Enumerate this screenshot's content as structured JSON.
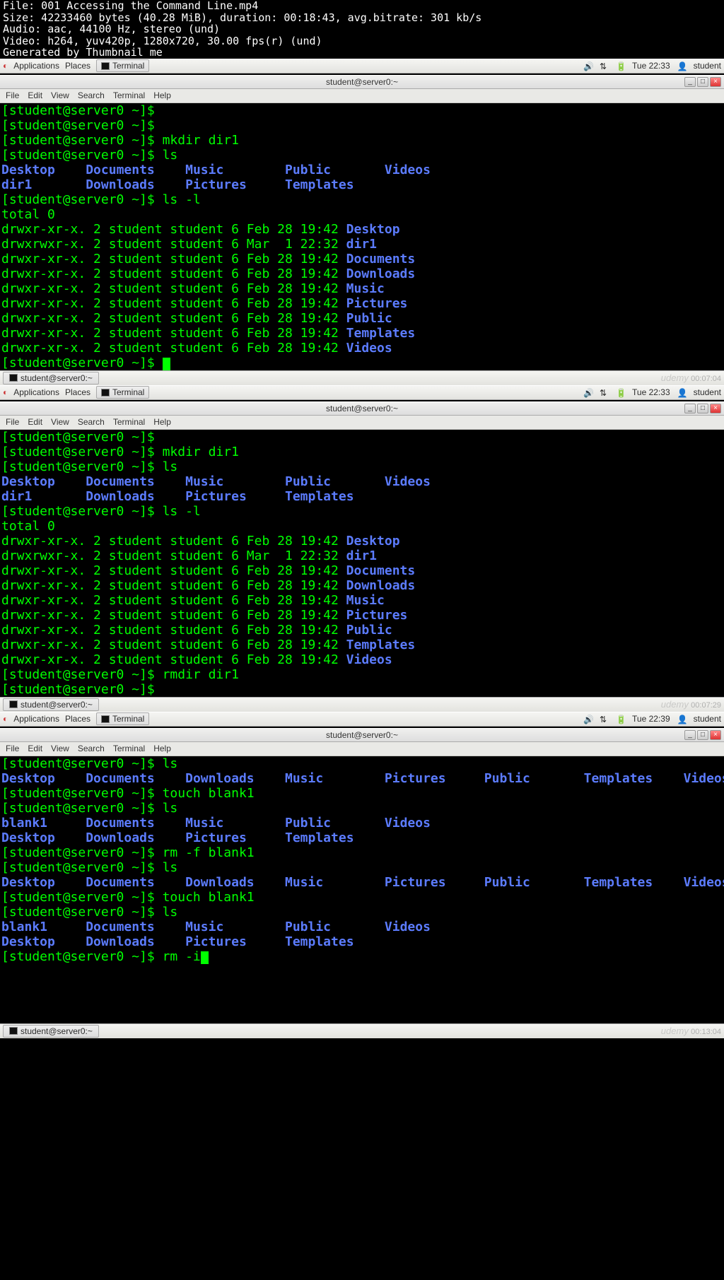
{
  "fileinfo": {
    "l1": "File: 001 Accessing the Command Line.mp4",
    "l2": "Size: 42233460 bytes (40.28 MiB), duration: 00:18:43, avg.bitrate: 301 kb/s",
    "l3": "Audio: aac, 44100 Hz, stereo (und)",
    "l4": "Video: h264, yuv420p, 1280x720, 30.00 fps(r) (und)",
    "l5": "Generated by Thumbnail me"
  },
  "panel": {
    "applications": "Applications",
    "places": "Places",
    "terminal": "Terminal",
    "clock1": "Tue 22:33",
    "clock2": "Tue 22:33",
    "clock3": "Tue 22:39",
    "user": "student"
  },
  "window": {
    "title": "student@server0:~",
    "menu": {
      "file": "File",
      "edit": "Edit",
      "view": "View",
      "search": "Search",
      "terminal": "Terminal",
      "help": "Help"
    },
    "min": "_",
    "max": "□",
    "close": "×"
  },
  "task": {
    "label": "student@server0:~"
  },
  "watermark": "udemy",
  "ts": {
    "t1": "00:07:04",
    "t2": "00:07:29",
    "t3": "00:13:04"
  },
  "prompt": "[student@server0 ~]$ ",
  "seg1": {
    "cmd1": "mkdir dir1",
    "cmd2": "ls",
    "lsrow1": [
      "Desktop",
      "Documents",
      "Music",
      "Public",
      "Videos"
    ],
    "lsrow2": [
      "dir1",
      "Downloads",
      "Pictures",
      "Templates"
    ],
    "cmd3": "ls -l",
    "total": "total 0",
    "rows": [
      {
        "p": "drwxr-xr-x. 2 student student 6 Feb 28 19:42 ",
        "n": "Desktop"
      },
      {
        "p": "drwxrwxr-x. 2 student student 6 Mar  1 22:32 ",
        "n": "dir1"
      },
      {
        "p": "drwxr-xr-x. 2 student student 6 Feb 28 19:42 ",
        "n": "Documents"
      },
      {
        "p": "drwxr-xr-x. 2 student student 6 Feb 28 19:42 ",
        "n": "Downloads"
      },
      {
        "p": "drwxr-xr-x. 2 student student 6 Feb 28 19:42 ",
        "n": "Music"
      },
      {
        "p": "drwxr-xr-x. 2 student student 6 Feb 28 19:42 ",
        "n": "Pictures"
      },
      {
        "p": "drwxr-xr-x. 2 student student 6 Feb 28 19:42 ",
        "n": "Public"
      },
      {
        "p": "drwxr-xr-x. 2 student student 6 Feb 28 19:42 ",
        "n": "Templates"
      },
      {
        "p": "drwxr-xr-x. 2 student student 6 Feb 28 19:42 ",
        "n": "Videos"
      }
    ]
  },
  "seg2": {
    "cmd1": "mkdir dir1",
    "cmd2": "ls",
    "cmd3": "ls -l",
    "cmd4": "rmdir dir1"
  },
  "seg3": {
    "cmd1": "ls",
    "lsA": [
      "Desktop",
      "Documents",
      "Downloads",
      "Music",
      "Pictures",
      "Public",
      "Templates",
      "Videos"
    ],
    "cmd2": "touch blank1",
    "cmd3": "ls",
    "lsB1": [
      "blank1",
      "Documents",
      "Music",
      "Public",
      "Videos"
    ],
    "lsB2": [
      "Desktop",
      "Downloads",
      "Pictures",
      "Templates"
    ],
    "cmd4": "rm -f blank1",
    "cmd5": "ls",
    "cmd6": "touch blank1",
    "cmd7": "ls",
    "cmd8": "rm -i"
  }
}
